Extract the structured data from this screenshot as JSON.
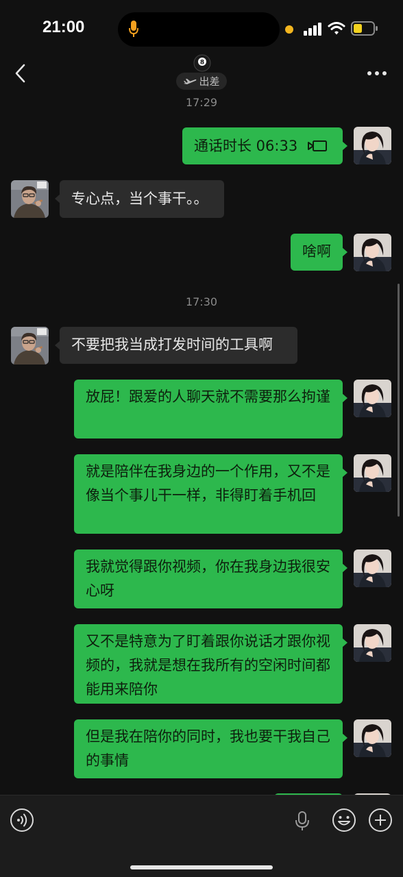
{
  "status_bar": {
    "time": "21:00",
    "icons": [
      "microphone-icon",
      "camera-indicator",
      "signal-icon",
      "wifi-icon",
      "battery-icon"
    ],
    "colors": {
      "mic": "#f3a01f",
      "battery_fill": "#f3d21f",
      "camera_dot": "#f3b51f"
    }
  },
  "nav": {
    "back_icon": "chevron-left-icon",
    "title_icon": "8-ball-emoji",
    "status_icon": "airplane-icon",
    "status_text": "出差",
    "more_icon": "more-dots-icon"
  },
  "chat": {
    "timestamps": [
      "17:29",
      "17:30"
    ],
    "messages": [
      {
        "sender": "me",
        "type": "call",
        "text": "通话时长 06:33",
        "icon": "video-call-icon"
      },
      {
        "sender": "other",
        "text": "专心点，当个事干。。"
      },
      {
        "sender": "me",
        "text": "啥啊"
      },
      {
        "sender": "other",
        "text": "不要把我当成打发时间的工具啊"
      },
      {
        "sender": "me",
        "text": "放屁！跟爱的人聊天就不需要那么拘谨"
      },
      {
        "sender": "me",
        "text": "就是陪伴在我身边的一个作用，又不是像当个事儿干一样，非得盯着手机回"
      },
      {
        "sender": "me",
        "text": "我就觉得跟你视频，你在我身边我很安心呀"
      },
      {
        "sender": "me",
        "text": "又不是特意为了盯着跟你说话才跟你视频的，我就是想在我所有的空闲时间都能用来陪你"
      },
      {
        "sender": "me",
        "text": "但是我在陪你的同时，我也要干我自己的事情"
      }
    ]
  },
  "input_bar": {
    "voice_icon": "voice-mode-icon",
    "input_value": "",
    "mic_icon": "microphone-icon",
    "emoji_icon": "emoji-icon",
    "plus_icon": "plus-icon"
  },
  "colors": {
    "background": "#111111",
    "my_bubble": "#2db84d",
    "other_bubble": "#2c2c2c",
    "input_bar": "#1c1c1c"
  }
}
